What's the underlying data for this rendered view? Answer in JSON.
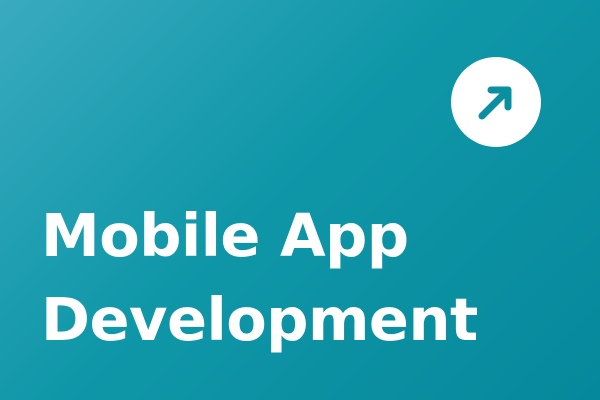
{
  "card": {
    "title_line_1": "Mobile App",
    "title_line_2": "Development",
    "action_icon": "arrow-up-right-icon",
    "colors": {
      "background_start": "#3aaabf",
      "background_end": "#06889b",
      "icon_circle": "#ffffff",
      "icon_arrow": "#0a8fa1",
      "title": "#ffffff"
    }
  }
}
